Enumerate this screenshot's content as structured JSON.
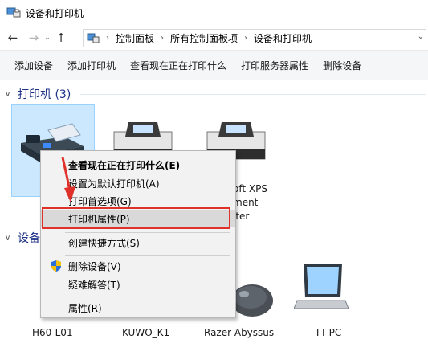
{
  "window": {
    "title": "设备和打印机"
  },
  "nav": {
    "back": "←",
    "forward": "→",
    "recent": "⌄",
    "up": "↑",
    "breadcrumbs": [
      "控制面板",
      "所有控制面板项",
      "设备和打印机"
    ]
  },
  "toolbar": {
    "items": [
      "添加设备",
      "添加打印机",
      "查看现在正在打印什么",
      "打印服务器属性",
      "删除设备"
    ]
  },
  "printers_group": {
    "title": "打印机 (3)"
  },
  "devices_group": {
    "title": "设备"
  },
  "printers": {
    "xps_line1": "oft XPS",
    "xps_line2": "ment",
    "xps_line3": "iter"
  },
  "devices": {
    "items": [
      "H60-L01",
      "KUWO_K1",
      "Razer Abyssus",
      "TT-PC"
    ]
  },
  "context_menu": {
    "items": [
      "查看现在正在打印什么(E)",
      "设置为默认打印机(A)",
      "打印首选项(G)",
      "打印机属性(P)",
      "创建快捷方式(S)",
      "删除设备(V)",
      "疑难解答(T)",
      "属性(R)"
    ]
  },
  "colors": {
    "highlight_border": "#e0302a",
    "arrow": "#e0302a",
    "group_header": "#1e3287",
    "selection_fill": "#cce8ff"
  }
}
